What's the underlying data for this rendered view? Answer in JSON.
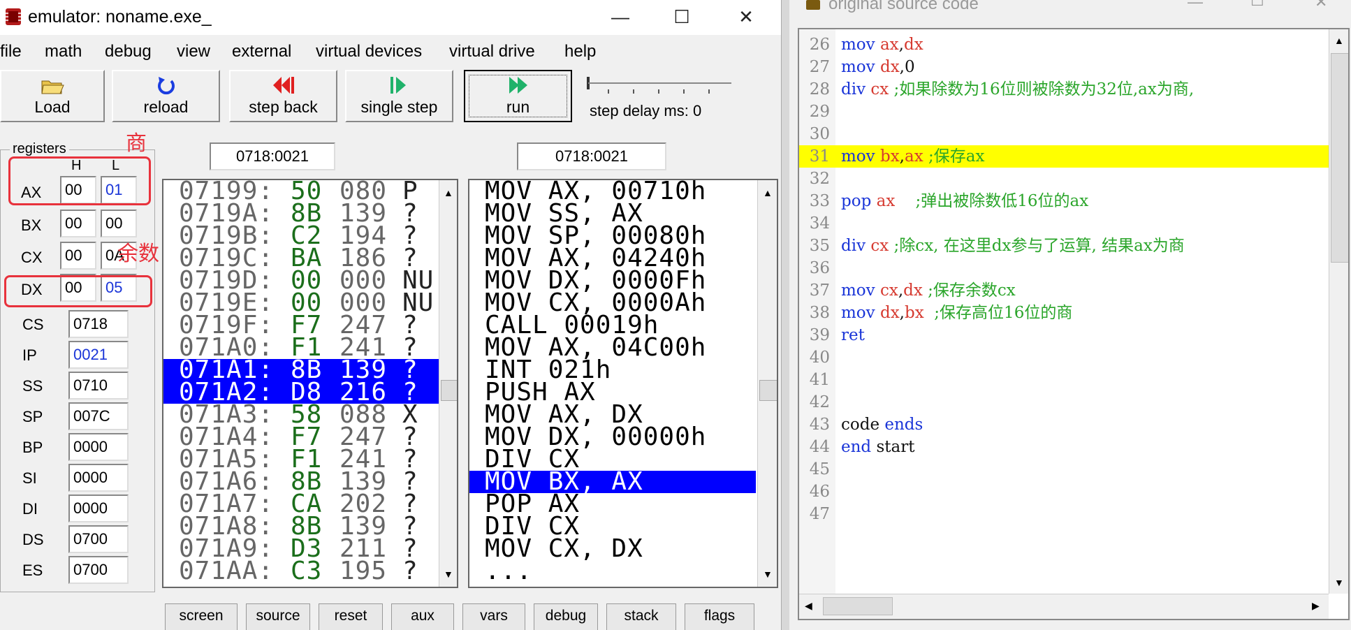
{
  "emulator": {
    "title": "emulator: noname.exe_",
    "window_controls": {
      "minimize": "—",
      "maximize": "☐",
      "close": "✕"
    },
    "menu": [
      "file",
      "math",
      "debug",
      "view",
      "external",
      "virtual devices",
      "virtual drive",
      "help"
    ],
    "toolbar": {
      "load": "Load",
      "reload": "reload",
      "step_back": "step back",
      "single_step": "single step",
      "run": "run",
      "step_delay": "step delay ms: 0"
    },
    "registers": {
      "group_label": "registers",
      "col_h": "H",
      "col_l": "L",
      "annotation_quotient": "商",
      "annotation_remainder": "余数",
      "split": [
        {
          "name": "AX",
          "h": "00",
          "l": "01"
        },
        {
          "name": "BX",
          "h": "00",
          "l": "00"
        },
        {
          "name": "CX",
          "h": "00",
          "l": "0A"
        },
        {
          "name": "DX",
          "h": "00",
          "l": "05"
        }
      ],
      "full": [
        {
          "name": "CS",
          "value": "0718"
        },
        {
          "name": "IP",
          "value": "0021"
        },
        {
          "name": "SS",
          "value": "0710"
        },
        {
          "name": "SP",
          "value": "007C"
        },
        {
          "name": "BP",
          "value": "0000"
        },
        {
          "name": "SI",
          "value": "0000"
        },
        {
          "name": "DI",
          "value": "0000"
        },
        {
          "name": "DS",
          "value": "0700"
        },
        {
          "name": "ES",
          "value": "0700"
        }
      ]
    },
    "memory_address": "0718:0021",
    "disasm_address": "0718:0021",
    "memory_rows": [
      {
        "addr": "07199:",
        "hex": "50",
        "dec": "080",
        "ch": "P"
      },
      {
        "addr": "0719A:",
        "hex": "8B",
        "dec": "139",
        "ch": "?"
      },
      {
        "addr": "0719B:",
        "hex": "C2",
        "dec": "194",
        "ch": "?"
      },
      {
        "addr": "0719C:",
        "hex": "BA",
        "dec": "186",
        "ch": "?"
      },
      {
        "addr": "0719D:",
        "hex": "00",
        "dec": "000",
        "ch": "NU"
      },
      {
        "addr": "0719E:",
        "hex": "00",
        "dec": "000",
        "ch": "NU"
      },
      {
        "addr": "0719F:",
        "hex": "F7",
        "dec": "247",
        "ch": "?"
      },
      {
        "addr": "071A0:",
        "hex": "F1",
        "dec": "241",
        "ch": "?"
      },
      {
        "addr": "071A1:",
        "hex": "8B",
        "dec": "139",
        "ch": "?"
      },
      {
        "addr": "071A2:",
        "hex": "D8",
        "dec": "216",
        "ch": "?"
      },
      {
        "addr": "071A3:",
        "hex": "58",
        "dec": "088",
        "ch": "X"
      },
      {
        "addr": "071A4:",
        "hex": "F7",
        "dec": "247",
        "ch": "?"
      },
      {
        "addr": "071A5:",
        "hex": "F1",
        "dec": "241",
        "ch": "?"
      },
      {
        "addr": "071A6:",
        "hex": "8B",
        "dec": "139",
        "ch": "?"
      },
      {
        "addr": "071A7:",
        "hex": "CA",
        "dec": "202",
        "ch": "?"
      },
      {
        "addr": "071A8:",
        "hex": "8B",
        "dec": "139",
        "ch": "?"
      },
      {
        "addr": "071A9:",
        "hex": "D3",
        "dec": "211",
        "ch": "?"
      },
      {
        "addr": "071AA:",
        "hex": "C3",
        "dec": "195",
        "ch": "?"
      }
    ],
    "disasm_rows": [
      "MOV AX, 00710h",
      "MOV SS, AX",
      "MOV SP, 00080h",
      "MOV AX, 04240h",
      "MOV DX, 0000Fh",
      "MOV CX, 0000Ah",
      "CALL 00019h",
      "MOV AX, 04C00h",
      "INT 021h",
      "PUSH AX",
      "MOV AX, DX",
      "MOV DX, 00000h",
      "DIV CX",
      "MOV BX, AX",
      "POP AX",
      "DIV CX",
      "MOV CX, DX",
      "..."
    ],
    "tabs": [
      "screen",
      "source",
      "reset",
      "aux",
      "vars",
      "debug",
      "stack",
      "flags"
    ]
  },
  "source": {
    "title": "original source code",
    "lines": [
      {
        "n": "26",
        "parts": [
          [
            "mov ",
            "blue"
          ],
          [
            "ax",
            "red"
          ],
          [
            ",",
            "black"
          ],
          [
            "dx",
            "red"
          ]
        ]
      },
      {
        "n": "27",
        "parts": [
          [
            "mov ",
            "blue"
          ],
          [
            "dx",
            "red"
          ],
          [
            ",0",
            "black"
          ]
        ]
      },
      {
        "n": "28",
        "parts": [
          [
            "div ",
            "blue"
          ],
          [
            "cx",
            "red"
          ],
          [
            " ;如果除数为16位则被除数为32位,ax为商,",
            "green"
          ]
        ]
      },
      {
        "n": "29",
        "parts": []
      },
      {
        "n": "30",
        "parts": []
      },
      {
        "n": "31",
        "parts": [
          [
            "mov ",
            "blue"
          ],
          [
            "bx",
            "red"
          ],
          [
            ",",
            "black"
          ],
          [
            "ax",
            "red"
          ],
          [
            " ;保存ax",
            "green"
          ]
        ]
      },
      {
        "n": "32",
        "parts": []
      },
      {
        "n": "33",
        "parts": [
          [
            "pop ",
            "blue"
          ],
          [
            "ax",
            "red"
          ],
          [
            "    ;弹出被除数低16位的ax",
            "green"
          ]
        ]
      },
      {
        "n": "34",
        "parts": []
      },
      {
        "n": "35",
        "parts": [
          [
            "div ",
            "blue"
          ],
          [
            "cx",
            "red"
          ],
          [
            " ;除cx, 在这里dx参与了运算, 结果ax为商",
            "green"
          ]
        ]
      },
      {
        "n": "36",
        "parts": []
      },
      {
        "n": "37",
        "parts": [
          [
            "mov ",
            "blue"
          ],
          [
            "cx",
            "red"
          ],
          [
            ",",
            "black"
          ],
          [
            "dx",
            "red"
          ],
          [
            " ;保存余数cx",
            "green"
          ]
        ]
      },
      {
        "n": "38",
        "parts": [
          [
            "mov ",
            "blue"
          ],
          [
            "dx",
            "red"
          ],
          [
            ",",
            "black"
          ],
          [
            "bx",
            "red"
          ],
          [
            "  ;保存高位16位的商",
            "green"
          ]
        ]
      },
      {
        "n": "39",
        "parts": [
          [
            "ret",
            "blue"
          ]
        ]
      },
      {
        "n": "40",
        "parts": []
      },
      {
        "n": "41",
        "parts": []
      },
      {
        "n": "42",
        "parts": []
      },
      {
        "n": "43",
        "parts": [
          [
            "code ",
            "black"
          ],
          [
            "ends",
            "blue"
          ]
        ]
      },
      {
        "n": "44",
        "parts": [
          [
            "end ",
            "blue"
          ],
          [
            "start",
            "black"
          ]
        ]
      },
      {
        "n": "45",
        "parts": []
      },
      {
        "n": "46",
        "parts": []
      },
      {
        "n": "47",
        "parts": []
      }
    ],
    "highlighted_line": "31"
  },
  "colors": {
    "selection_blue": "#0000ff",
    "source_highlight": "#ffff00",
    "annotation_red": "#e8323c",
    "hex_green": "#1b6e1b",
    "register_blue": "#1a35d8"
  }
}
